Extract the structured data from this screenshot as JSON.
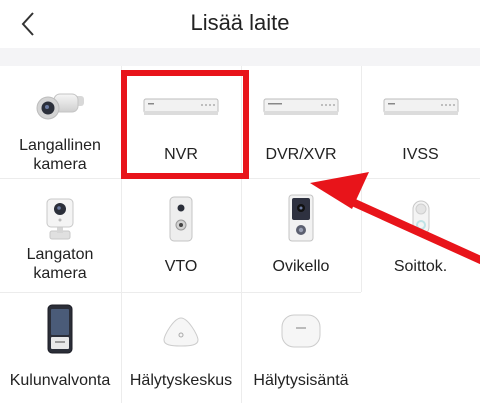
{
  "header": {
    "title": "Lisää laite",
    "back_icon": "chevron-left-icon"
  },
  "devices": [
    {
      "id": "wired-camera",
      "label": "Langallinen kamera",
      "icon": "bullet-camera-icon"
    },
    {
      "id": "nvr",
      "label": "NVR",
      "icon": "nvr-recorder-icon"
    },
    {
      "id": "dvr-xvr",
      "label": "DVR/XVR",
      "icon": "dvr-recorder-icon"
    },
    {
      "id": "ivss",
      "label": "IVSS",
      "icon": "ivss-recorder-icon"
    },
    {
      "id": "wireless-camera",
      "label": "Langaton kamera",
      "icon": "cube-camera-icon"
    },
    {
      "id": "vto",
      "label": "VTO",
      "icon": "vto-intercom-icon"
    },
    {
      "id": "doorbell",
      "label": "Ovikello",
      "icon": "doorbell-icon"
    },
    {
      "id": "chime",
      "label": "Soittok.",
      "icon": "chime-icon"
    },
    {
      "id": "access-control",
      "label": "Kulunvalvonta",
      "icon": "access-terminal-icon"
    },
    {
      "id": "alarm-hub",
      "label": "Hälytyskeskus",
      "icon": "alarm-hub-icon"
    },
    {
      "id": "alarm-host",
      "label": "Hälytysisäntä",
      "icon": "alarm-host-icon"
    }
  ],
  "annotation": {
    "color": "#e8141a",
    "target": "nvr"
  }
}
